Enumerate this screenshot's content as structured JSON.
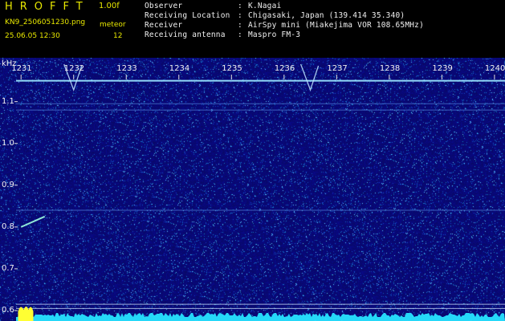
{
  "header": {
    "logo": "HROFFT",
    "version": "1.00f",
    "filename": "KN9_2506051230.png",
    "meteor_label": "meteor",
    "timestamp": "25.06.05 12:30",
    "meteor_count": "12"
  },
  "info": [
    {
      "key": "Observer",
      "value": "K.Nagai"
    },
    {
      "key": "Receiving Location",
      "value": "Chigasaki, Japan (139.414 35.340)"
    },
    {
      "key": "Receiver",
      "value": "AirSpy mini (Miakejima VOR 108.65MHz)"
    },
    {
      "key": "Receiving antenna",
      "value": "Maspro FM-3"
    }
  ],
  "colors": {
    "accent_yellow": "#e8e800",
    "background": "#000000",
    "spectrogram_base": "#0a0a7a",
    "signal_line": "#9be6ff",
    "baseline_noise": "#27e4ff",
    "meteor_blob": "#ffff33"
  },
  "chart_data": {
    "type": "heatmap",
    "ylabel": "kHz",
    "x_ticks": [
      "1231",
      "1232",
      "1233",
      "1234",
      "1235",
      "1236",
      "1237",
      "1238",
      "1239",
      "1240"
    ],
    "y_ticks": [
      "1.1",
      "1.0",
      "0.9",
      "0.8",
      "0.7",
      "0.6"
    ],
    "x_range": [
      1230.6,
      1240.2
    ],
    "y_range": [
      0.575,
      1.205
    ],
    "horizontal_lines_khz": [
      1.15,
      1.095,
      1.08,
      0.84,
      0.605,
      0.615
    ],
    "meteor_trails": [
      {
        "x_start": 1231.0,
        "x_end": 1231.45,
        "y_start": 0.8,
        "y_end": 0.825
      }
    ],
    "head_echoes_x": [
      1232.0,
      1236.5
    ]
  }
}
